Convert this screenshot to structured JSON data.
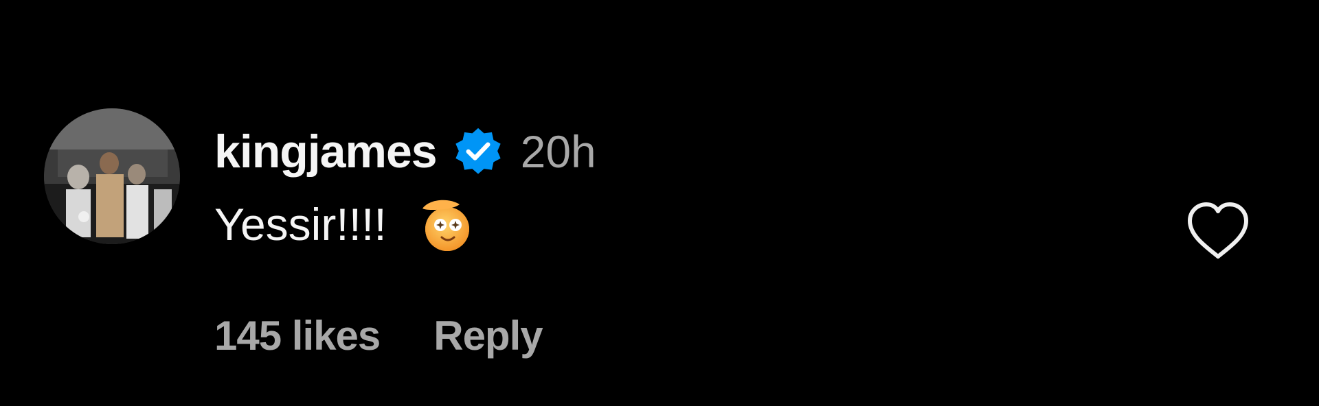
{
  "comment": {
    "username": "kingjames",
    "verified_icon": "verified-badge-icon",
    "timestamp": "20h",
    "text": "Yessir!!!!",
    "emoji_icon": "face-with-cowboy-hat-emoji",
    "likes": "145 likes",
    "reply_label": "Reply",
    "like_icon": "heart-outline-icon"
  },
  "colors": {
    "background": "#000000",
    "username": "#f5f5f5",
    "secondary_text": "#a8a8a8",
    "verified": "#0095f6"
  }
}
